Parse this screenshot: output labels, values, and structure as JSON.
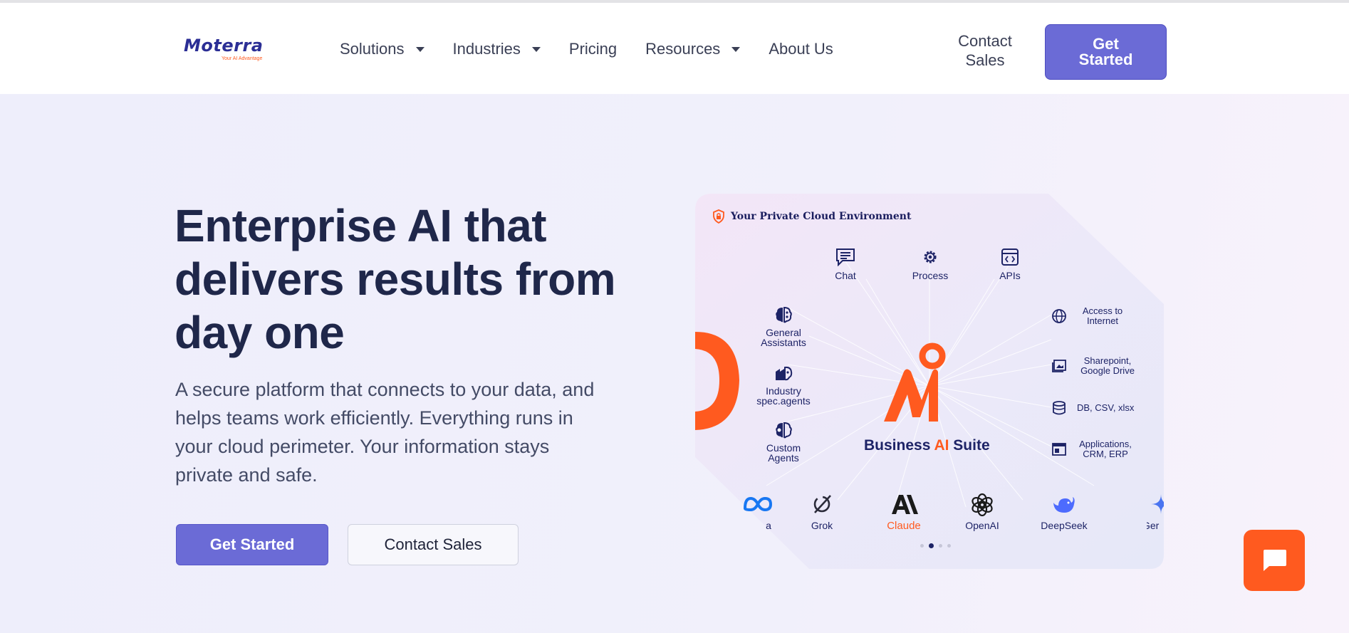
{
  "brand": {
    "name": "Moterra",
    "tagline": "Your AI Advantage",
    "accent_color": "#6b6bd6",
    "orange_color": "#ff5a1f",
    "navy_color": "#1d2366"
  },
  "nav": {
    "items": [
      {
        "label": "Solutions",
        "dropdown": true
      },
      {
        "label": "Industries",
        "dropdown": true
      },
      {
        "label": "Pricing",
        "dropdown": false
      },
      {
        "label": "Resources",
        "dropdown": true
      },
      {
        "label": "About Us",
        "dropdown": false
      }
    ],
    "contact_sales": "Contact Sales",
    "get_started": "Get Started"
  },
  "hero": {
    "title": "Enterprise AI that delivers results from day one",
    "subtitle": "A secure platform that connects to your data, and helps teams work efficiently. Everything runs in your cloud perimeter. Your information stays private and safe.",
    "primary_button": "Get Started",
    "secondary_button": "Contact Sales"
  },
  "diagram": {
    "environment_label": "Your Private Cloud Environment",
    "top_nodes": [
      {
        "label": "Chat",
        "icon": "chat-icon"
      },
      {
        "label": "Process",
        "icon": "gear-icon"
      },
      {
        "label": "APIs",
        "icon": "code-window-icon"
      }
    ],
    "left_nodes": [
      {
        "label": "General Assistants",
        "icon": "brain-icon"
      },
      {
        "label": "Industry spec.agents",
        "icon": "factory-brain-icon"
      },
      {
        "label": "Custom Agents",
        "icon": "gear-brain-icon"
      }
    ],
    "right_nodes": [
      {
        "label": "Access to Internet",
        "icon": "globe-icon"
      },
      {
        "label": "Sharepoint, Google Drive",
        "icon": "folder-image-icon"
      },
      {
        "label": "DB, CSV, xlsx",
        "icon": "database-icon"
      },
      {
        "label": "Applications, CRM, ERP",
        "icon": "app-window-icon"
      }
    ],
    "center": {
      "prefix": "Business",
      "highlight": "AI",
      "suffix": "Suite"
    },
    "providers": [
      {
        "label": "a",
        "icon": "meta-logo-icon"
      },
      {
        "label": "Grok",
        "icon": "grok-logo-icon"
      },
      {
        "label": "Claude",
        "icon": "anthropic-logo-icon"
      },
      {
        "label": "OpenAI",
        "icon": "openai-logo-icon"
      },
      {
        "label": "DeepSeek",
        "icon": "deepseek-logo-icon"
      },
      {
        "label": "Ger",
        "icon": "gemini-logo-icon"
      }
    ],
    "carousel_active_index": 1,
    "carousel_count": 4
  },
  "chat_widget": {
    "icon": "chat-bubble-icon"
  }
}
